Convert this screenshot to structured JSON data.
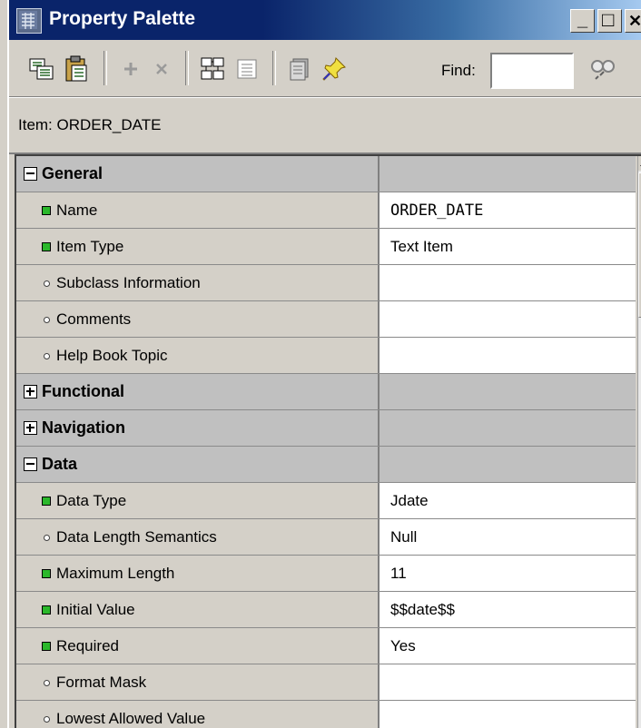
{
  "window": {
    "title": "Property Palette",
    "controls": {
      "minimize": "_",
      "maximize": "□",
      "close": "✕"
    }
  },
  "toolbar": {
    "find_label": "Find:",
    "find_value": "",
    "icons": [
      "copy-properties-icon",
      "paste-properties-icon",
      "add-property-icon",
      "delete-property-icon",
      "union-icon",
      "intersection-icon",
      "inherit-icon",
      "freeze-icon",
      "find-icon"
    ]
  },
  "context": {
    "label": "Item: ORDER_DATE"
  },
  "properties": [
    {
      "kind": "category",
      "label": "General",
      "expanded": true,
      "value": ""
    },
    {
      "kind": "prop",
      "label": "Name",
      "value": "ORDER_DATE",
      "changed": true,
      "mono": true
    },
    {
      "kind": "prop",
      "label": "Item Type",
      "value": "Text Item",
      "changed": true
    },
    {
      "kind": "prop",
      "label": "Subclass Information",
      "value": "",
      "changed": false
    },
    {
      "kind": "prop",
      "label": "Comments",
      "value": "",
      "changed": false
    },
    {
      "kind": "prop",
      "label": "Help Book Topic",
      "value": "",
      "changed": false
    },
    {
      "kind": "category",
      "label": "Functional",
      "expanded": false,
      "value": ""
    },
    {
      "kind": "category",
      "label": "Navigation",
      "expanded": false,
      "value": ""
    },
    {
      "kind": "category",
      "label": "Data",
      "expanded": true,
      "value": ""
    },
    {
      "kind": "prop",
      "label": "Data Type",
      "value": "Jdate",
      "changed": true
    },
    {
      "kind": "prop",
      "label": "Data Length Semantics",
      "value": "Null",
      "changed": false
    },
    {
      "kind": "prop",
      "label": "Maximum Length",
      "value": "11",
      "changed": true
    },
    {
      "kind": "prop",
      "label": "Initial Value",
      "value": "$$date$$",
      "changed": true
    },
    {
      "kind": "prop",
      "label": "Required",
      "value": "Yes",
      "changed": true
    },
    {
      "kind": "prop",
      "label": "Format Mask",
      "value": "",
      "changed": false
    },
    {
      "kind": "prop",
      "label": "Lowest Allowed Value",
      "value": "",
      "changed": false
    }
  ]
}
